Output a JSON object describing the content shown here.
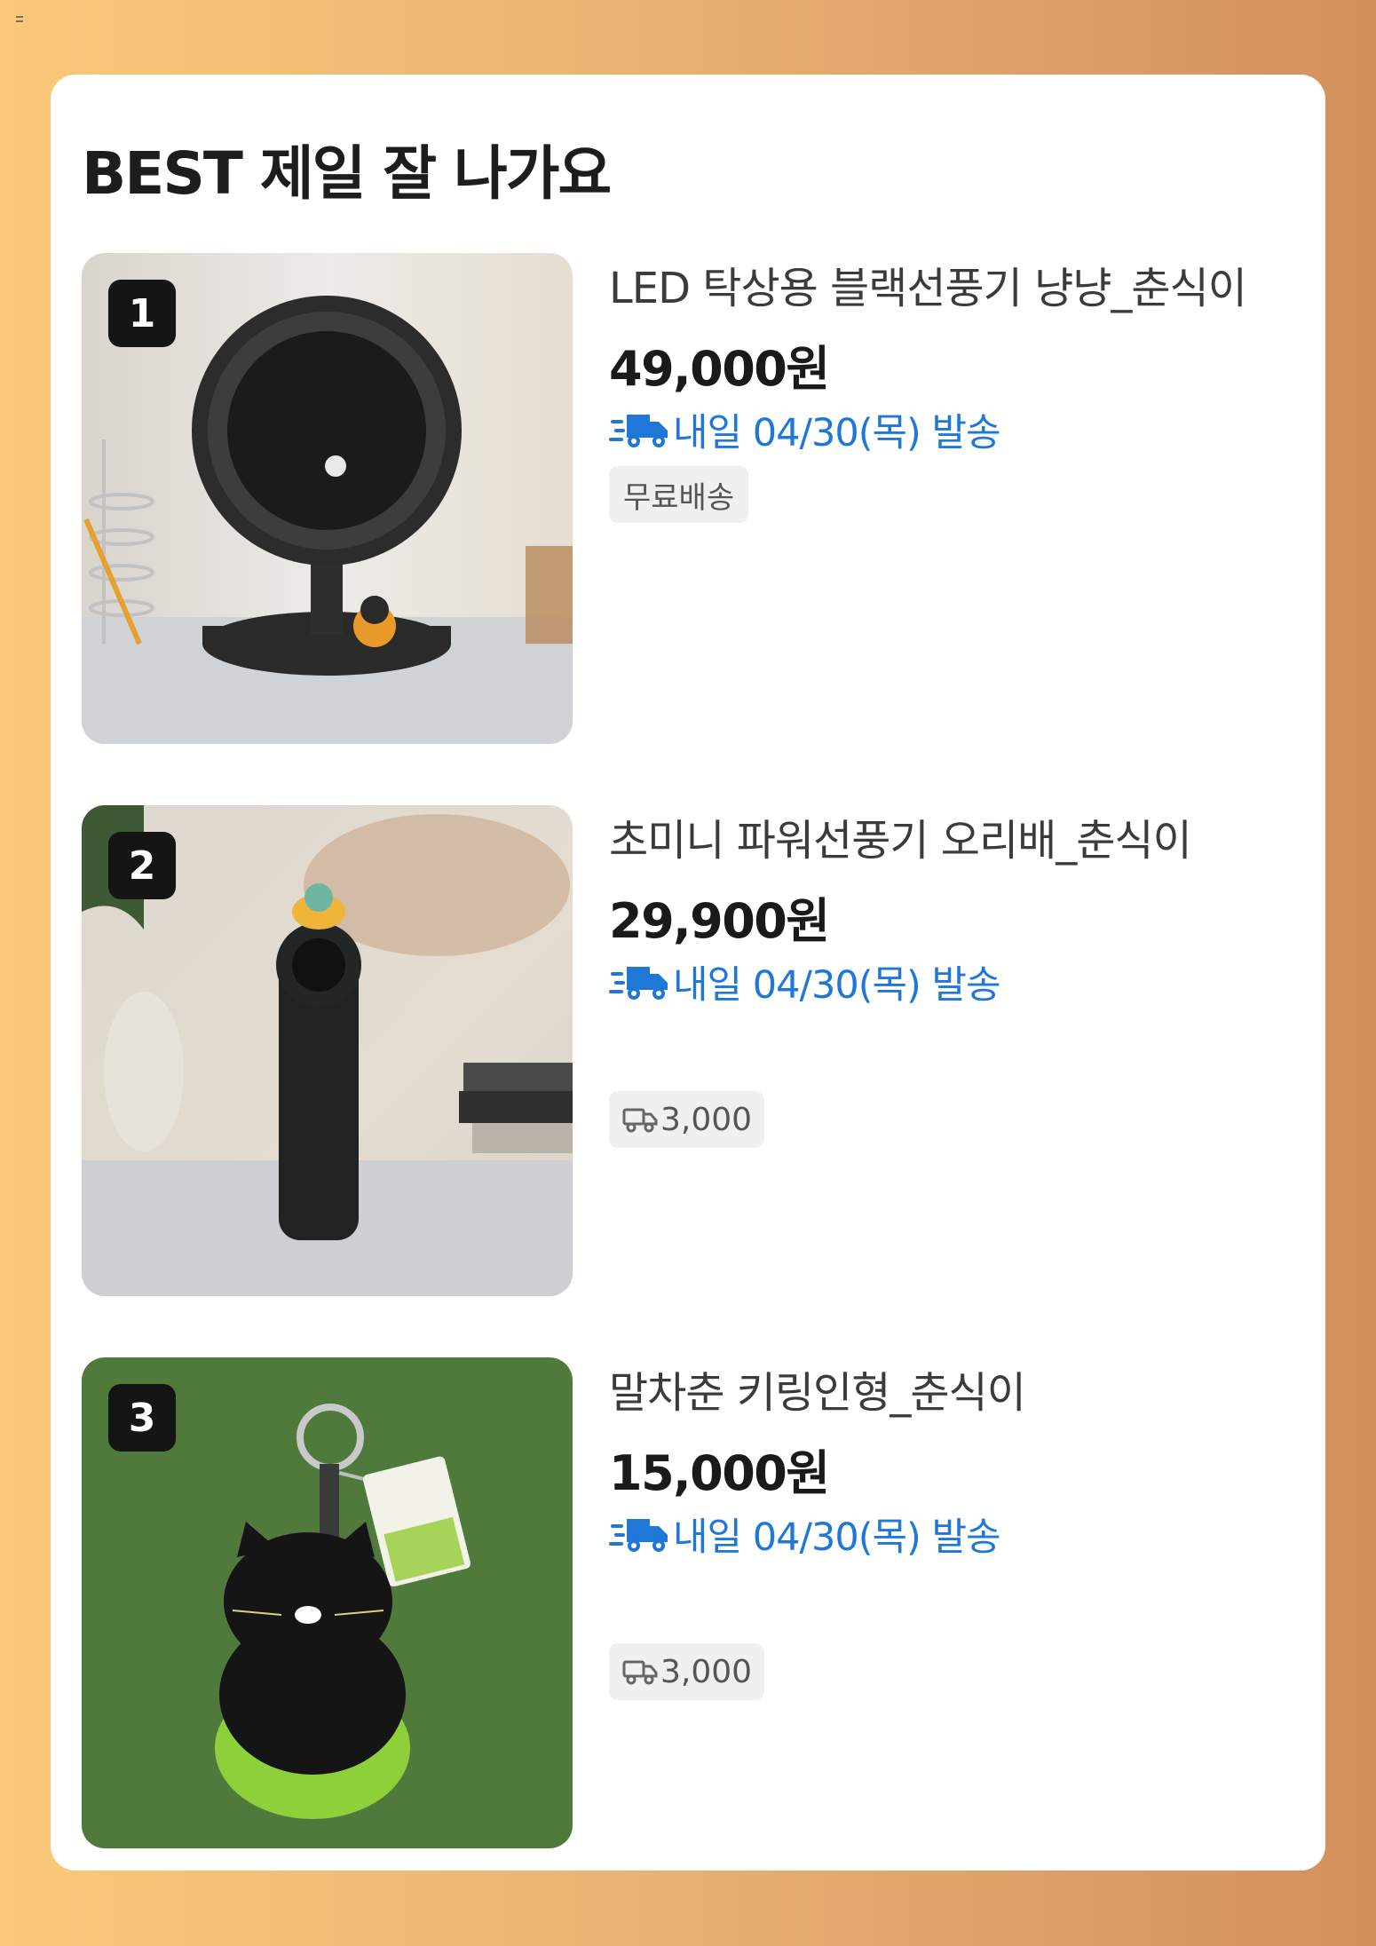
{
  "section": {
    "title": "BEST 제일 잘 나가요"
  },
  "products": [
    {
      "rank": "1",
      "name": "LED 탁상용 블랙선풍기 냥냥_춘식이",
      "price": "49,000원",
      "shipping": "내일 04/30(목) 발송",
      "delivery_tag": "무료배송",
      "image_icon": "desk-fan-photo"
    },
    {
      "rank": "2",
      "name": "초미니 파워선풍기 오리배_춘식이",
      "price": "29,900원",
      "shipping": "내일 04/30(목) 발송",
      "delivery_fee": "3,000",
      "image_icon": "handheld-fan-photo"
    },
    {
      "rank": "3",
      "name": "말차춘 키링인형_춘식이",
      "price": "15,000원",
      "shipping": "내일 04/30(목) 발송",
      "delivery_fee": "3,000",
      "image_icon": "keyring-plush-photo"
    }
  ],
  "icons": {
    "shipping": "fast-truck-icon",
    "fee": "truck-outline-icon"
  },
  "colors": {
    "shipping_text": "#1f77d8",
    "rank_badge": "#151515",
    "tag_bg": "#f0f0f0"
  }
}
